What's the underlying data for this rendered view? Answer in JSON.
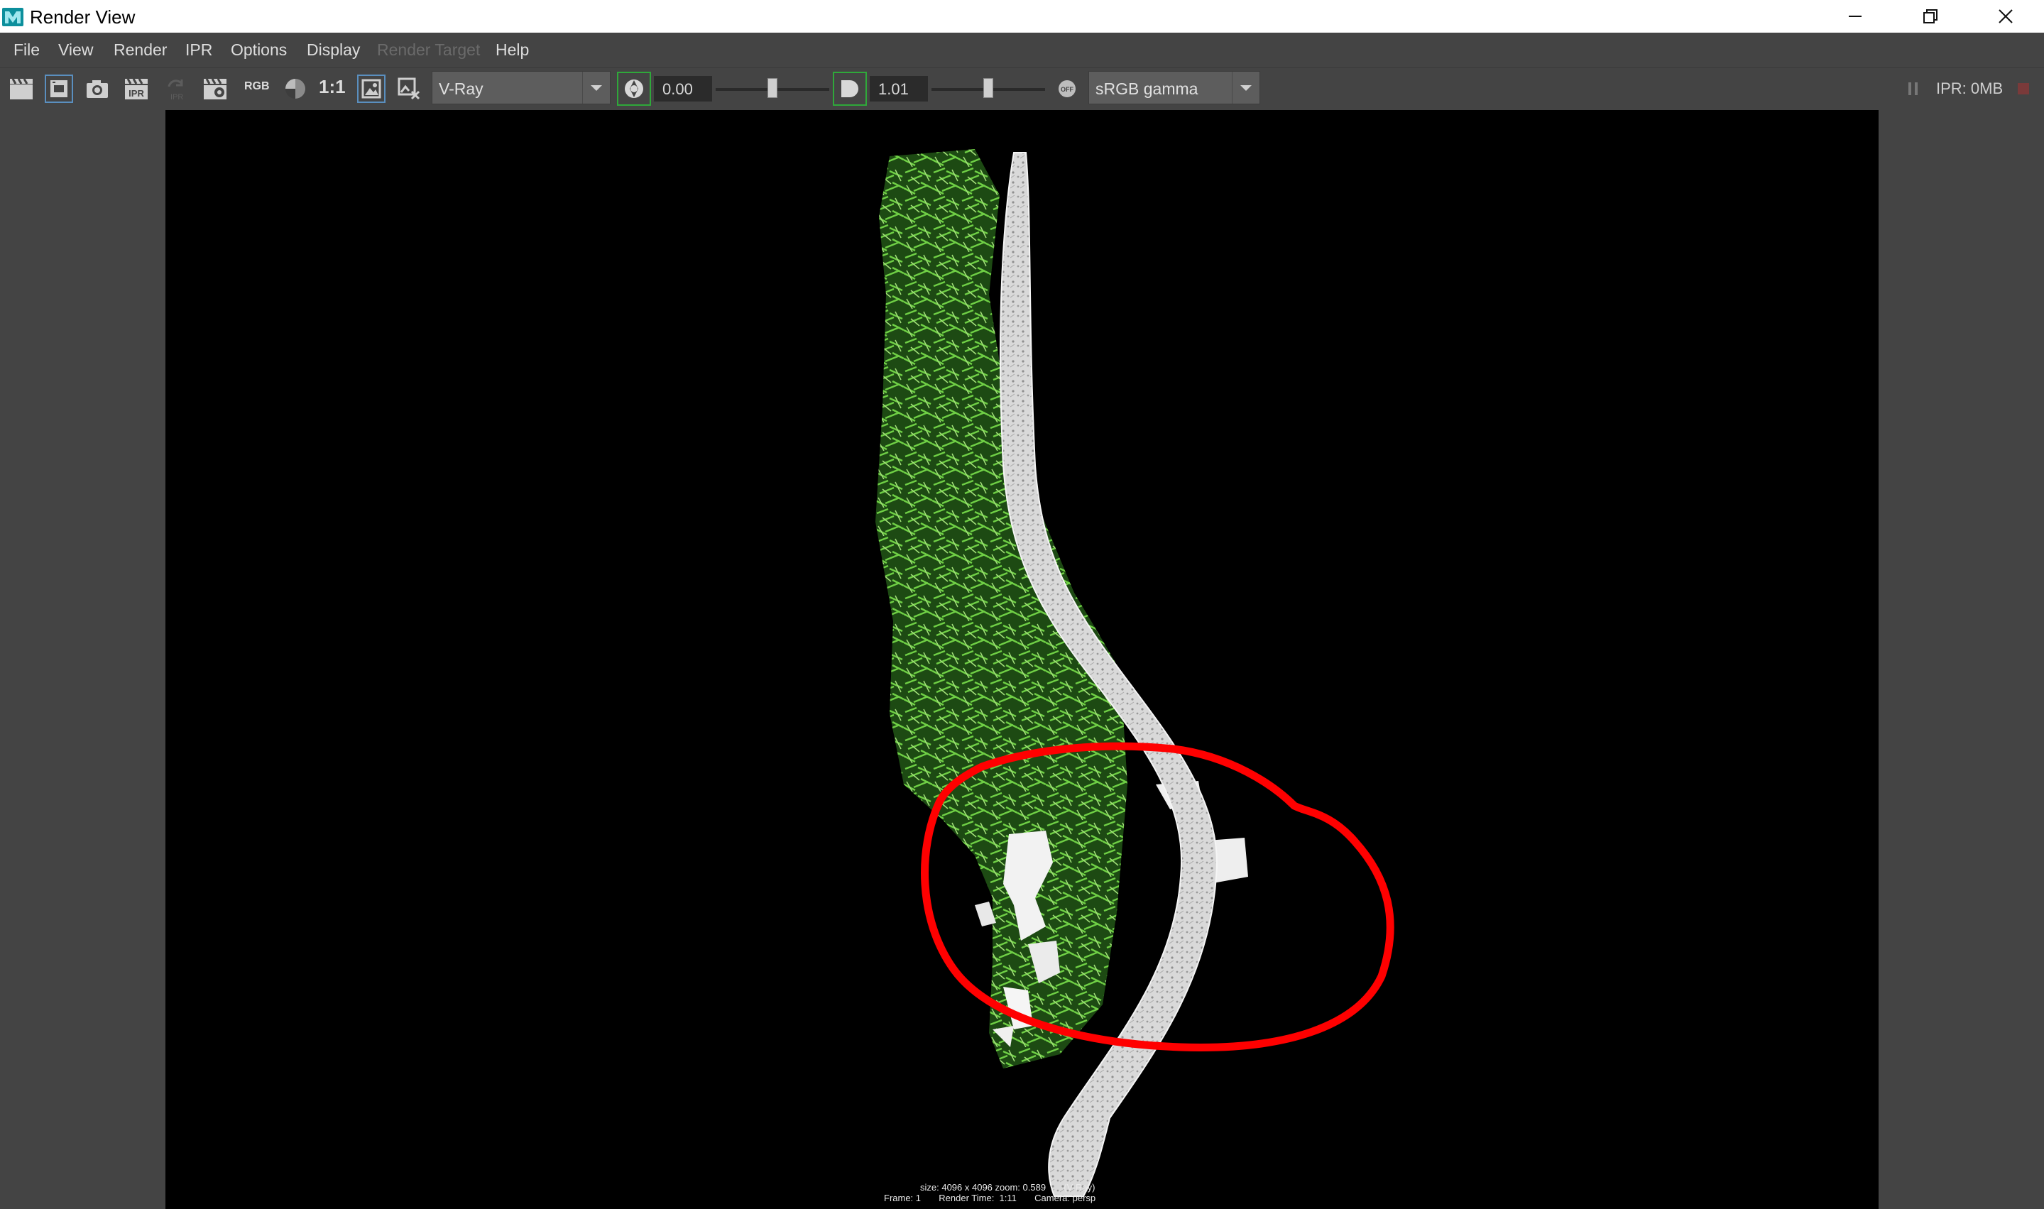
{
  "window": {
    "title": "Render View",
    "minimize_icon": "minimize-icon",
    "maximize_icon": "restore-icon",
    "close_icon": "close-icon"
  },
  "menu": {
    "items": [
      {
        "label": "File",
        "enabled": true
      },
      {
        "label": "View",
        "enabled": true
      },
      {
        "label": "Render",
        "enabled": true
      },
      {
        "label": "IPR",
        "enabled": true
      },
      {
        "label": "Options",
        "enabled": true
      },
      {
        "label": "Display",
        "enabled": true
      },
      {
        "label": "Render Target",
        "enabled": false
      },
      {
        "label": "Help",
        "enabled": true
      }
    ]
  },
  "toolbar": {
    "rgb_label": "RGB",
    "ipr_label": "IPR",
    "one_to_one_label": "1:1",
    "renderer": "V-Ray",
    "exposure_value": "0.00",
    "exposure_level": 0.5,
    "gamma_value": "1.01",
    "gamma_level": 0.5,
    "colorspace": "sRGB gamma",
    "off_label": "OFF",
    "ipr_memory": "IPR: 0MB",
    "accent_green": "#2fa83a"
  },
  "render": {
    "info_line1": "size: 4096 x 4096 zoom: 0.589       (V-Ray)",
    "info_line2": "Frame: 1       Render Time:  1:11       Camera: persp",
    "annotation_color": "#ff0000",
    "foliage_color": "#4caf2e",
    "trunk_color": "#dcdcdc"
  }
}
